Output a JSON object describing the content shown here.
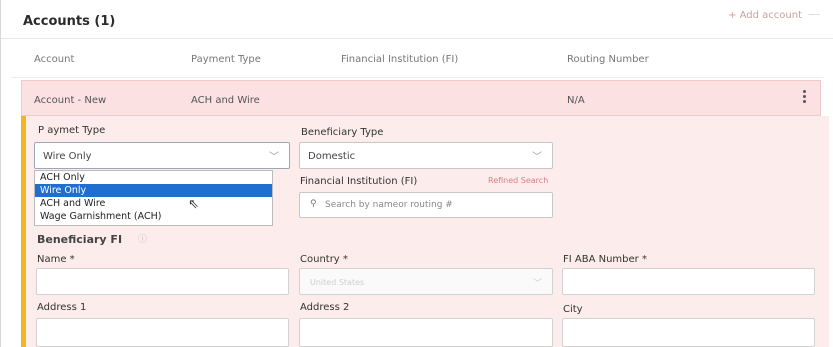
{
  "panel": {
    "title": "Accounts (1)",
    "add_account": "+ Add account",
    "add_account_icon": "collapse-icon"
  },
  "table": {
    "headers": [
      "Account",
      "Payment Type",
      "Financial Institution (FI)",
      "Routing Number"
    ],
    "row": {
      "account": "Account - New",
      "payment_type": "ACH and Wire",
      "fi": "",
      "routing": "N/A"
    }
  },
  "form": {
    "payment_type_label": "P aymet Type",
    "payment_type_value": "Wire Only",
    "payment_type_options": [
      "ACH Only",
      "Wire Only",
      "ACH and Wire",
      "Wage Garnishment (ACH)"
    ],
    "payment_type_selected_index": 1,
    "beneficiary_type_label": "Beneficiary Type",
    "beneficiary_type_value": "Domestic",
    "fi_label": "Financial Institution (FI)",
    "refined_search": "Refined Search",
    "fi_search_placeholder": "Search by nameor routing #",
    "beneficiary_fi_heading": "Beneficiary FI",
    "name_label": "Name *",
    "country_label": "Country *",
    "country_value": "United States",
    "fi_aba_label": "FI ABA Number *",
    "address1_label": "Address 1",
    "address2_label": "Address 2",
    "city_label": "City"
  },
  "colors": {
    "accent_bar": "#f2b71e",
    "selected_row_bg": "#fbe1e1",
    "dropdown_highlight": "#1f6fd1",
    "link": "#c9a0a0"
  }
}
